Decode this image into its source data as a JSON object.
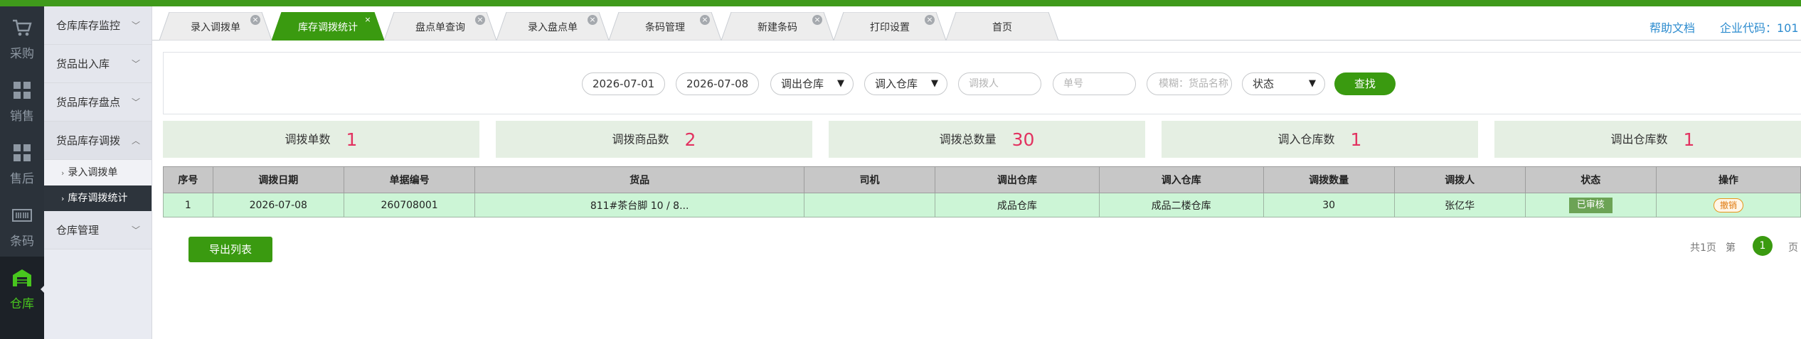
{
  "rail": [
    {
      "label": "采购",
      "icon": "cart-icon"
    },
    {
      "label": "销售",
      "icon": "sales-grid-icon"
    },
    {
      "label": "售后",
      "icon": "aftersale-grid-icon"
    },
    {
      "label": "条码",
      "icon": "barcode-icon"
    },
    {
      "label": "仓库",
      "icon": "warehouse-icon"
    }
  ],
  "menu": {
    "groups": [
      {
        "label": "仓库库存监控"
      },
      {
        "label": "货品出入库"
      },
      {
        "label": "货品库存盘点"
      },
      {
        "label": "货品库存调拨"
      }
    ],
    "subs": [
      {
        "label": "录入调拨单"
      },
      {
        "label": "库存调拨统计"
      }
    ],
    "last_group": {
      "label": "仓库管理"
    }
  },
  "tabs": [
    {
      "label": "录入调拨单"
    },
    {
      "label": "库存调拨统计"
    },
    {
      "label": "盘点单查询"
    },
    {
      "label": "录入盘点单"
    },
    {
      "label": "条码管理"
    },
    {
      "label": "新建条码"
    },
    {
      "label": "打印设置"
    },
    {
      "label": "首页"
    }
  ],
  "header": {
    "help": "帮助文档",
    "company": "企业代码：101"
  },
  "filter": {
    "date_from": "2026-07-01",
    "date_to": "2026-07-08",
    "out_wh": "调出仓库",
    "in_wh": "调入仓库",
    "person_ph": "调拨人",
    "order_ph": "单号",
    "fuzzy_ph": "模糊：货品名称",
    "status": "状态",
    "search": "查找",
    "dropdown_glyph": "▼"
  },
  "stats": [
    {
      "label": "调拨单数",
      "value": "1"
    },
    {
      "label": "调拨商品数",
      "value": "2"
    },
    {
      "label": "调拨总数量",
      "value": "30"
    },
    {
      "label": "调入仓库数",
      "value": "1"
    },
    {
      "label": "调出仓库数",
      "value": "1"
    }
  ],
  "table": {
    "headers": [
      "序号",
      "调拨日期",
      "单据编号",
      "货品",
      "司机",
      "调出仓库",
      "调入仓库",
      "调拨数量",
      "调拨人",
      "状态",
      "操作"
    ],
    "rows": [
      {
        "no": "1",
        "date": "2026-07-08",
        "code": "260708001",
        "goods": "811#茶台脚 10 / 8...",
        "driver": "",
        "out_wh": "成品仓库",
        "in_wh": "成品二楼仓库",
        "qty": "30",
        "person": "张亿华",
        "status": "已审核",
        "action": "撤销"
      }
    ]
  },
  "export": "导出列表",
  "pager": {
    "total": "共1页",
    "di": "第",
    "current": "1",
    "ye": "页"
  },
  "colors": {
    "brand_green": "#3a9a10",
    "top_bar": "#3f9a1b",
    "stat_value": "#e23260",
    "link_blue": "#2d8ccf"
  }
}
